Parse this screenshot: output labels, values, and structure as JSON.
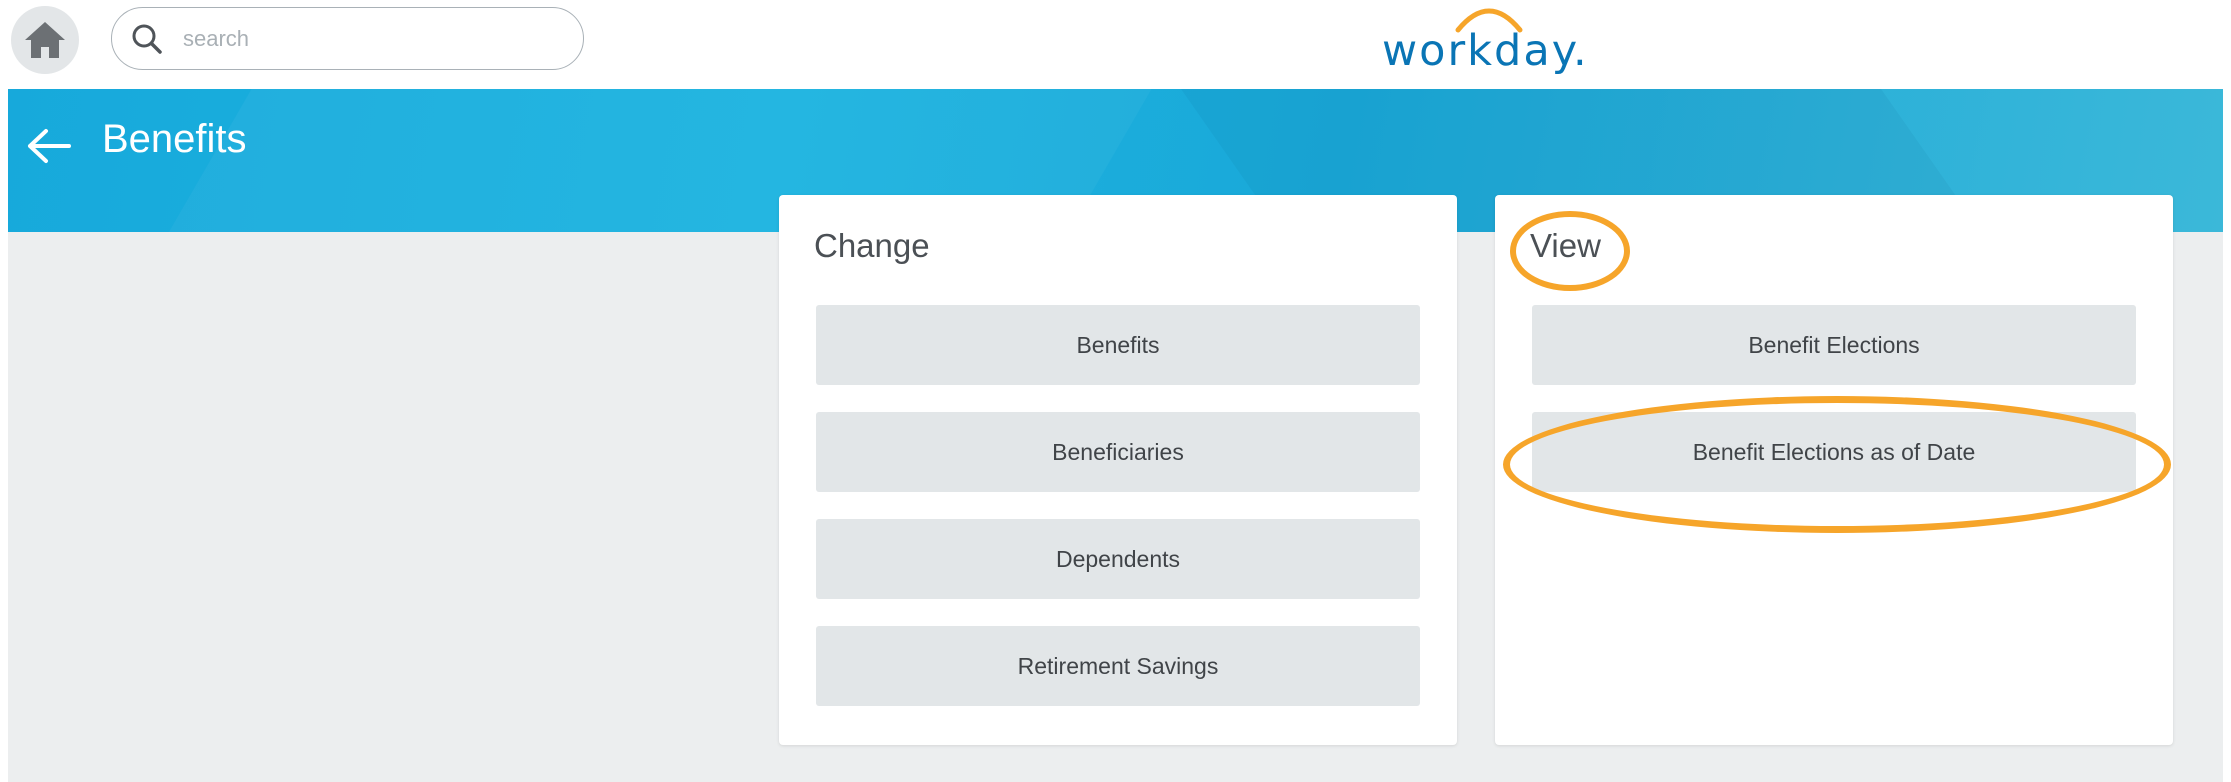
{
  "search": {
    "placeholder": "search"
  },
  "logo": {
    "text": "workday."
  },
  "header": {
    "title": "Benefits"
  },
  "change_card": {
    "title": "Change",
    "buttons": [
      "Benefits",
      "Beneficiaries",
      "Dependents",
      "Retirement Savings"
    ]
  },
  "view_card": {
    "title": "View",
    "buttons": [
      "Benefit Elections",
      "Benefit Elections as of Date"
    ]
  },
  "colors": {
    "banner": "#1cb3e0",
    "annotation": "#f6a52a",
    "button_bg": "#e2e6e8",
    "logo": "#0a75b5"
  }
}
